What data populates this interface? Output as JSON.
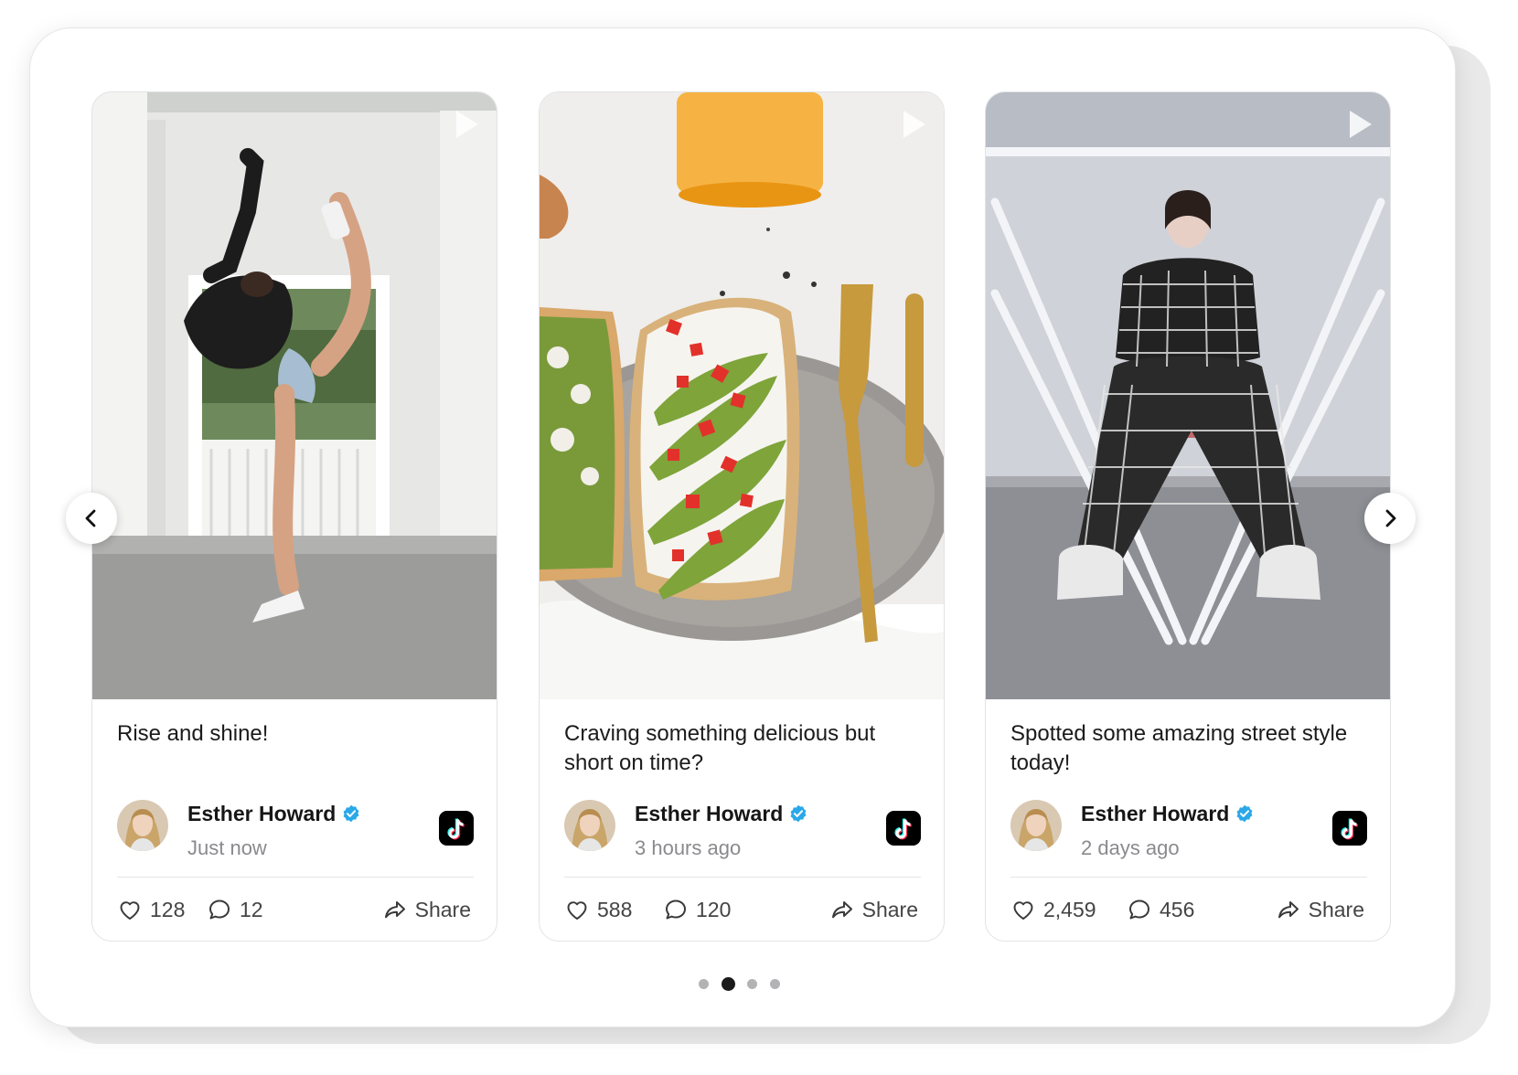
{
  "carousel": {
    "prev_icon": "chevron-left-icon",
    "next_icon": "chevron-right-icon",
    "pagination": {
      "pages": 4,
      "active_page": 2
    }
  },
  "posts": [
    {
      "caption": "Rise and shine!",
      "author": "Esther Howard",
      "verified": true,
      "timestamp": "Just now",
      "platform_icon": "tiktok-icon",
      "likes": "128",
      "comments": "12",
      "share_label": "Share",
      "media_type": "video"
    },
    {
      "caption": "Craving something delicious but short on time?",
      "author": "Esther Howard",
      "verified": true,
      "timestamp": "3 hours ago",
      "platform_icon": "tiktok-icon",
      "likes": "588",
      "comments": "120",
      "share_label": "Share",
      "media_type": "video"
    },
    {
      "caption": "Spotted some amazing street style today!",
      "author": "Esther Howard",
      "verified": true,
      "timestamp": "2 days ago",
      "platform_icon": "tiktok-icon",
      "likes": "2,459",
      "comments": "456",
      "share_label": "Share",
      "media_type": "video"
    }
  ],
  "colors": {
    "verified_badge": "#2aa8e8",
    "text_primary": "#161616",
    "text_secondary": "#8a8a8e",
    "active_dot": "#1b1b1b",
    "inactive_dot": "#b3b3b6"
  }
}
